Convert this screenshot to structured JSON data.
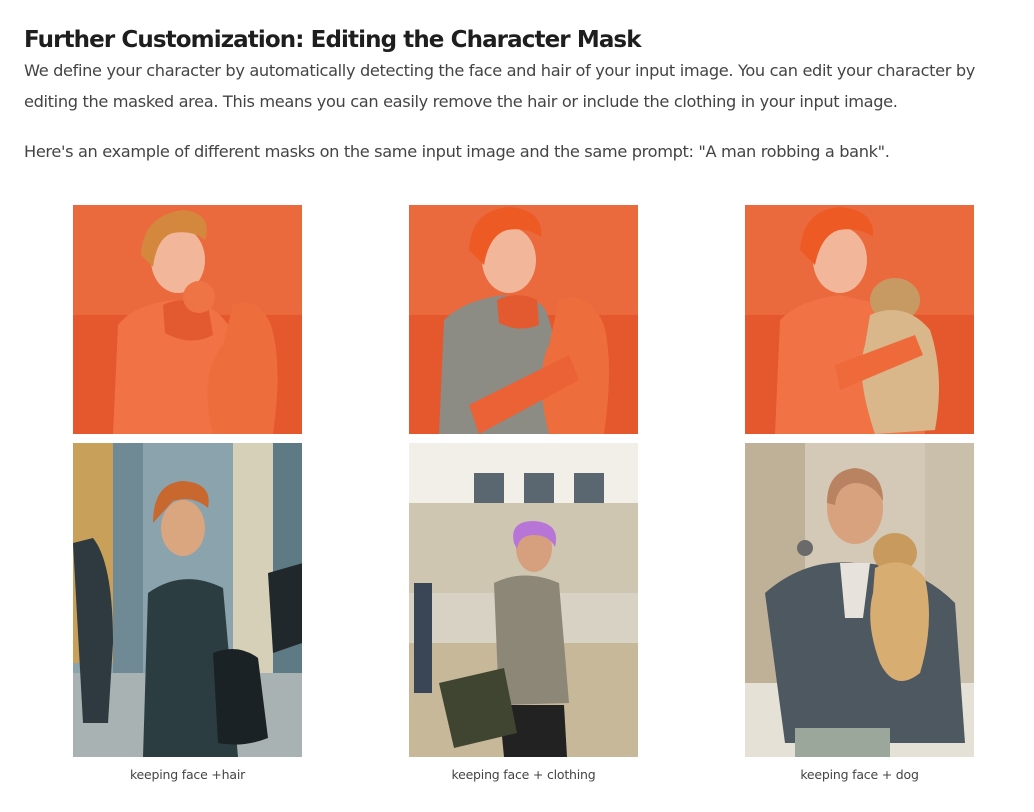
{
  "article": {
    "title": "Further Customization: Editing the Character Mask",
    "paragraph1": "We define your character by automatically  detecting the face and hair of your input image. You can edit your character by editing the masked area. This means you can easily remove the hair or include the clothing in your input image.",
    "paragraph2": "Here's an example of different masks on the same input image and  the same prompt: \"A man robbing a bank\"."
  },
  "examples": [
    {
      "mask_image": "masked-input-face-hair",
      "result_image": "result-face-hair",
      "caption": "keeping face +hair"
    },
    {
      "mask_image": "masked-input-face-clothing",
      "result_image": "result-face-clothing",
      "caption": "keeping face + clothing"
    },
    {
      "mask_image": "masked-input-face-dog",
      "result_image": "result-face-dog",
      "caption": "keeping face + dog"
    }
  ],
  "colors": {
    "mask_orange": "#ef6a3a",
    "mask_bg": "#e8552c",
    "text": "#444444",
    "title": "#1e1e1e"
  }
}
